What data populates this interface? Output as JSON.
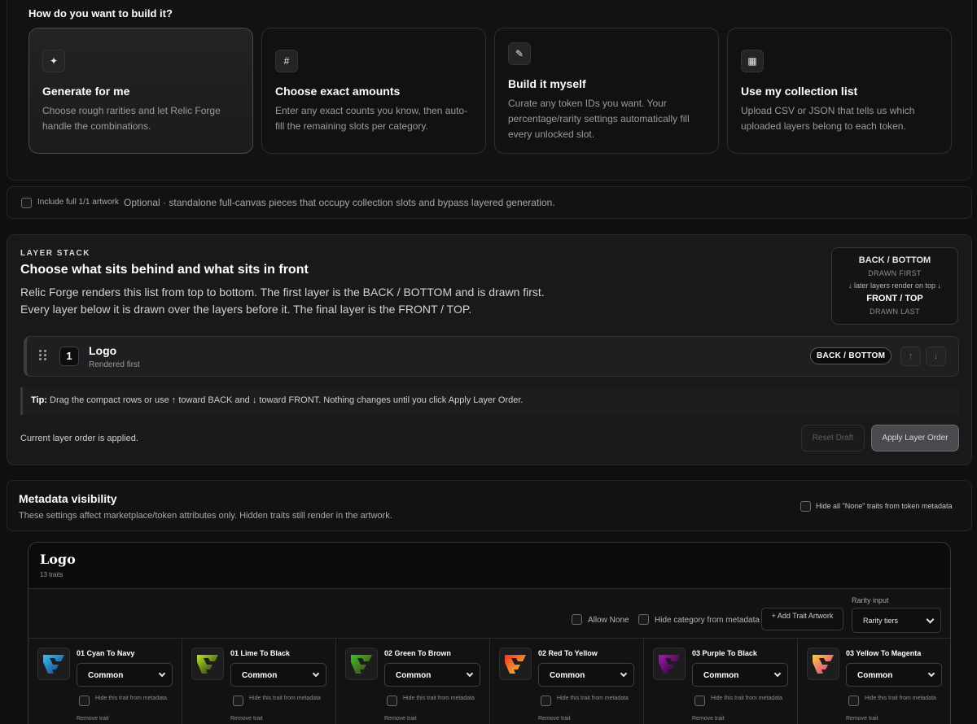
{
  "build": {
    "title": "How do you want to build it?",
    "cards": [
      {
        "icon": "sparkle-icon",
        "glyph": "✦",
        "title": "Generate for me",
        "desc": "Choose rough rarities and let Relic Forge handle the combinations."
      },
      {
        "icon": "hash-icon",
        "glyph": "#",
        "title": "Choose exact amounts",
        "desc": "Enter any exact counts you know, then auto-fill the remaining slots per category."
      },
      {
        "icon": "pencil-icon",
        "glyph": "✎",
        "title": "Build it myself",
        "desc": "Curate any token IDs you want. Your percentage/rarity settings automatically fill every unlocked slot."
      },
      {
        "icon": "grid-icon",
        "glyph": "▦",
        "title": "Use my collection list",
        "desc": "Upload CSV or JSON that tells us which uploaded layers belong to each token."
      }
    ]
  },
  "include": {
    "label": "Include full 1/1 artwork",
    "desc": "Optional · standalone full-canvas pieces that occupy collection slots and bypass layered generation."
  },
  "layer_stack": {
    "eyebrow": "LAYER STACK",
    "title": "Choose what sits behind and what sits in front",
    "desc_line1": "Relic Forge renders this list from top to bottom. The first layer is the BACK / BOTTOM and is drawn first.",
    "desc_line2": "Every layer below it is drawn over the layers before it. The final layer is the FRONT / TOP.",
    "order_box": {
      "back": "BACK / BOTTOM",
      "back_sub": "DRAWN FIRST",
      "middle": "↓ later layers render on top ↓",
      "front": "FRONT / TOP",
      "front_sub": "DRAWN LAST"
    },
    "layers": [
      {
        "index": "1",
        "name": "Logo",
        "sub": "Rendered first",
        "badge": "BACK / BOTTOM",
        "up": "↑",
        "down": "↓"
      }
    ],
    "tip_label": "Tip:",
    "tip_text": " Drag the compact rows or use ↑ toward BACK and ↓ toward FRONT. Nothing changes until you click Apply Layer Order.",
    "status": "Current layer order is applied.",
    "reset_label": "Reset Draft",
    "apply_label": "Apply Layer Order"
  },
  "metadata": {
    "title": "Metadata visibility",
    "desc": "These settings affect marketplace/token attributes only. Hidden traits still render in the artwork.",
    "hide_none_label": "Hide all \"None\" traits from token metadata"
  },
  "trait_panel": {
    "title": "Logo",
    "count": "13 traits",
    "allow_none_label": "Allow None",
    "hide_category_label": "Hide category from metadata",
    "add_art_label": "+ Add Trait Artwork",
    "rarity_label": "Rarity input",
    "rarity_value": "Rarity tiers",
    "hide_trait_label": "Hide this trait from metadata",
    "remove_label": "Remove trait",
    "traits": [
      {
        "name": "01 Cyan To Navy",
        "rarity": "Common",
        "color_a": "#36c6ee",
        "color_b": "#1a2f8a"
      },
      {
        "name": "01 Lime To Black",
        "rarity": "Common",
        "color_a": "#b8e62a",
        "color_b": "#1a2a08"
      },
      {
        "name": "02 Green To Brown",
        "rarity": "Common",
        "color_a": "#3fbf2a",
        "color_b": "#4a3a12"
      },
      {
        "name": "02 Red To Yellow",
        "rarity": "Common",
        "color_a": "#f0332a",
        "color_b": "#f5d02a"
      },
      {
        "name": "03 Purple To Black",
        "rarity": "Common",
        "color_a": "#a51ab5",
        "color_b": "#1a061c"
      },
      {
        "name": "03 Yellow To Magenta",
        "rarity": "Common",
        "color_a": "#f6d23a",
        "color_b": "#e0299a"
      }
    ]
  }
}
